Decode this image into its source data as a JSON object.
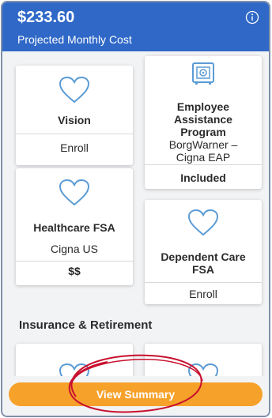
{
  "header": {
    "amount": "$233.60",
    "label": "Projected Monthly Cost",
    "info_icon": "info-circle-icon"
  },
  "cards": [
    {
      "icon": "heart-icon",
      "title": "Vision",
      "subtitle": "",
      "action": "Enroll"
    },
    {
      "icon": "safe-icon",
      "title": "Employee Assistance Program",
      "subtitle": "BorgWarner – Cigna EAP",
      "action": "Included"
    },
    {
      "icon": "heart-icon",
      "title": "Healthcare FSA",
      "subtitle": "Cigna US",
      "action": "$$"
    },
    {
      "icon": "heart-icon",
      "title": "Dependent Care FSA",
      "subtitle": "",
      "action": "Enroll"
    }
  ],
  "section": {
    "title": "Insurance & Retirement"
  },
  "footer": {
    "button_label": "View Summary"
  },
  "colors": {
    "header_bg": "#2f68c7",
    "button_bg": "#f6a12a",
    "icon_blue": "#5b9bd5",
    "annotation_red": "#c8102e"
  }
}
